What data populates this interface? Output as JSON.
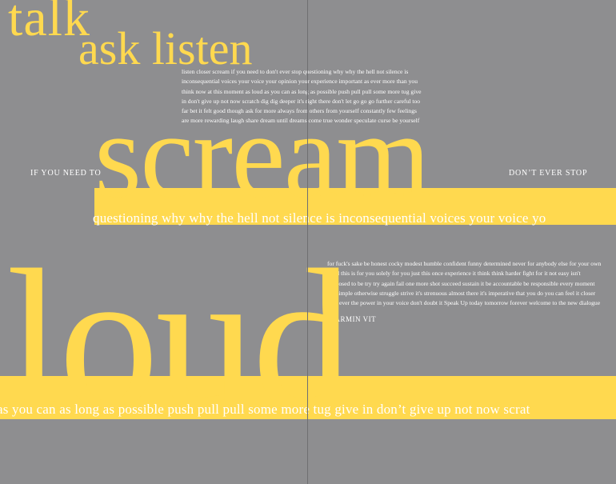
{
  "headline": {
    "word1": "talk",
    "word2": "ask listen",
    "word3": "scream",
    "word4": "loud"
  },
  "captions": {
    "left": "IF YOU NEED TO",
    "right": "DON’T EVER STOP"
  },
  "paragraphs": {
    "top": "listen closer scream if you need to don't ever stop questioning why why the hell not silence is inconsequential voices your voice your opinion your experience important as ever more than you think now at this moment as loud as you can as long as possible push pull pull some more tug give in don't give up not now scratch dig dig deeper it's right there don't let go go go further careful too far bet it felt good though ask for more always from others from yourself constantly few feelings are more rewarding laugh share dream until dreams come true wonder speculate curse be yourself",
    "right": "for fuck's sake be honest cocky modest humble confident funny determined never for anybody else for your own good this is for you solely for you just this once experience it think think harder fight for it not easy isn't supposed to be try try again fail one more shot succeed sustain it be accountable be responsible every moment too simple otherwise struggle strive it's strenuous almost there it's imperative that you do you can feel it closer than ever the power in your voice don't doubt it Speak Up today tomorrow forever welcome to the new dialogue"
  },
  "strips": {
    "top": "questioning why why the hell not silence is inconsequential voices your voice yo",
    "bottom": "as you can as long as possible push pull pull some more tug give in don’t give up not now scrat"
  },
  "signature": "—ARMIN VIT",
  "colors": {
    "background": "#8e8e90",
    "accent": "#ffd94f",
    "text": "#ffffff"
  }
}
